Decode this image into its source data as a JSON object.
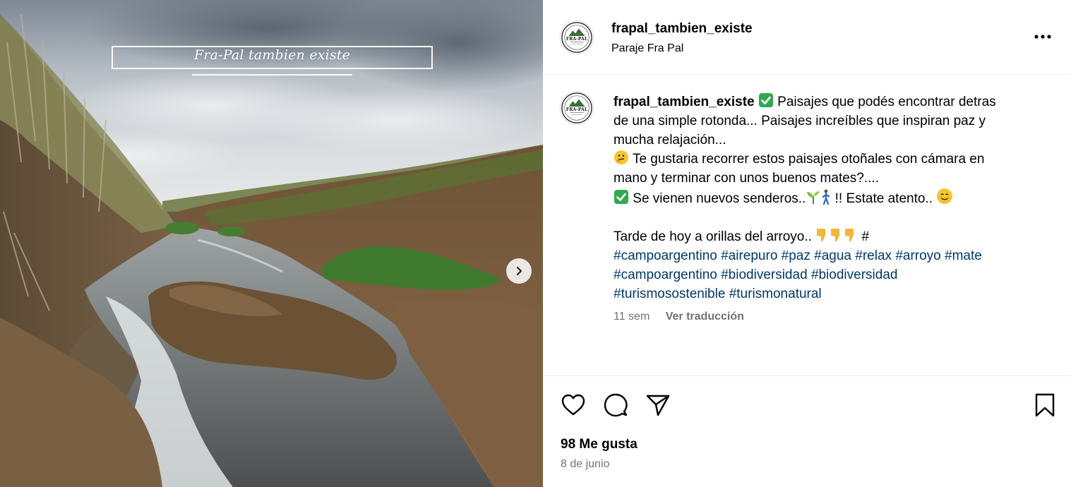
{
  "colors": {
    "text": "#000000",
    "secondary_text": "#737373",
    "hashtag": "#00376b",
    "divider": "#efefef",
    "check_green": "#32a852"
  },
  "media": {
    "overlay_title": "Fra-Pal tambien existe",
    "next_icon": "chevron-right-icon"
  },
  "header": {
    "username": "frapal_tambien_existe",
    "location": "Paraje Fra Pal",
    "avatar_text": "FRA-PAL",
    "more_icon": "more-horizontal-icon"
  },
  "caption": {
    "username": "frapal_tambien_existe",
    "line1": "Paisajes que podés encontrar detras",
    "line2": "de una simple rotonda... Paisajes increíbles que inspiran paz y",
    "line3": "mucha relajación...",
    "line4": "Te gustaria recorrer estos paisajes otoñales con cámara en",
    "line5": "mano y terminar con unos buenos mates?....",
    "line6a": "Se vienen nuevos senderos..",
    "line6b": "!! Estate atento..",
    "line7": "Tarde de hoy a orillas del arroyo..",
    "line7_hash": "#",
    "hashtags_row1": [
      "#campoargentino",
      "#airepuro",
      "#paz",
      "#agua",
      "#relax",
      "#arroyo",
      "#mate"
    ],
    "hashtags_row2": [
      "#campoargentino",
      "#biodiversidad",
      "#biodiversidad"
    ],
    "hashtags_row3": [
      "#turismosostenible",
      "#turismonatural"
    ],
    "time": "11 sem",
    "translate": "Ver traducción"
  },
  "actions": {
    "like_icon": "heart-icon",
    "comment_icon": "comment-icon",
    "share_icon": "send-icon",
    "save_icon": "bookmark-icon",
    "likes": "98 Me gusta",
    "date": "8 de junio"
  }
}
